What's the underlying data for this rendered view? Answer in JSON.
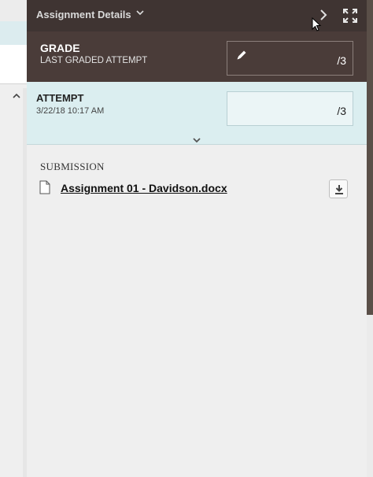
{
  "header": {
    "title": "Assignment Details",
    "caret_glyph": "⌄",
    "icons": [
      "chevron-right-icon",
      "expand-icon"
    ]
  },
  "grade": {
    "title": "GRADE",
    "subtitle": "LAST GRADED ATTEMPT",
    "out_of": "/3",
    "icon": "pencil-icon"
  },
  "attempt": {
    "title": "ATTEMPT",
    "date": "3/22/18 10:17 AM",
    "out_of": "/3",
    "icon": "chevron-down-icon"
  },
  "submission": {
    "heading": "SUBMISSION",
    "file_name": "Assignment 01 - Davidson.docx",
    "icons": [
      "file-icon",
      "download-icon"
    ]
  },
  "colors": {
    "header_bg": "#3f3432",
    "grade_bg": "#4a3c39",
    "attempt_bg": "#dbeef0",
    "panel_bg": "#efefef"
  }
}
